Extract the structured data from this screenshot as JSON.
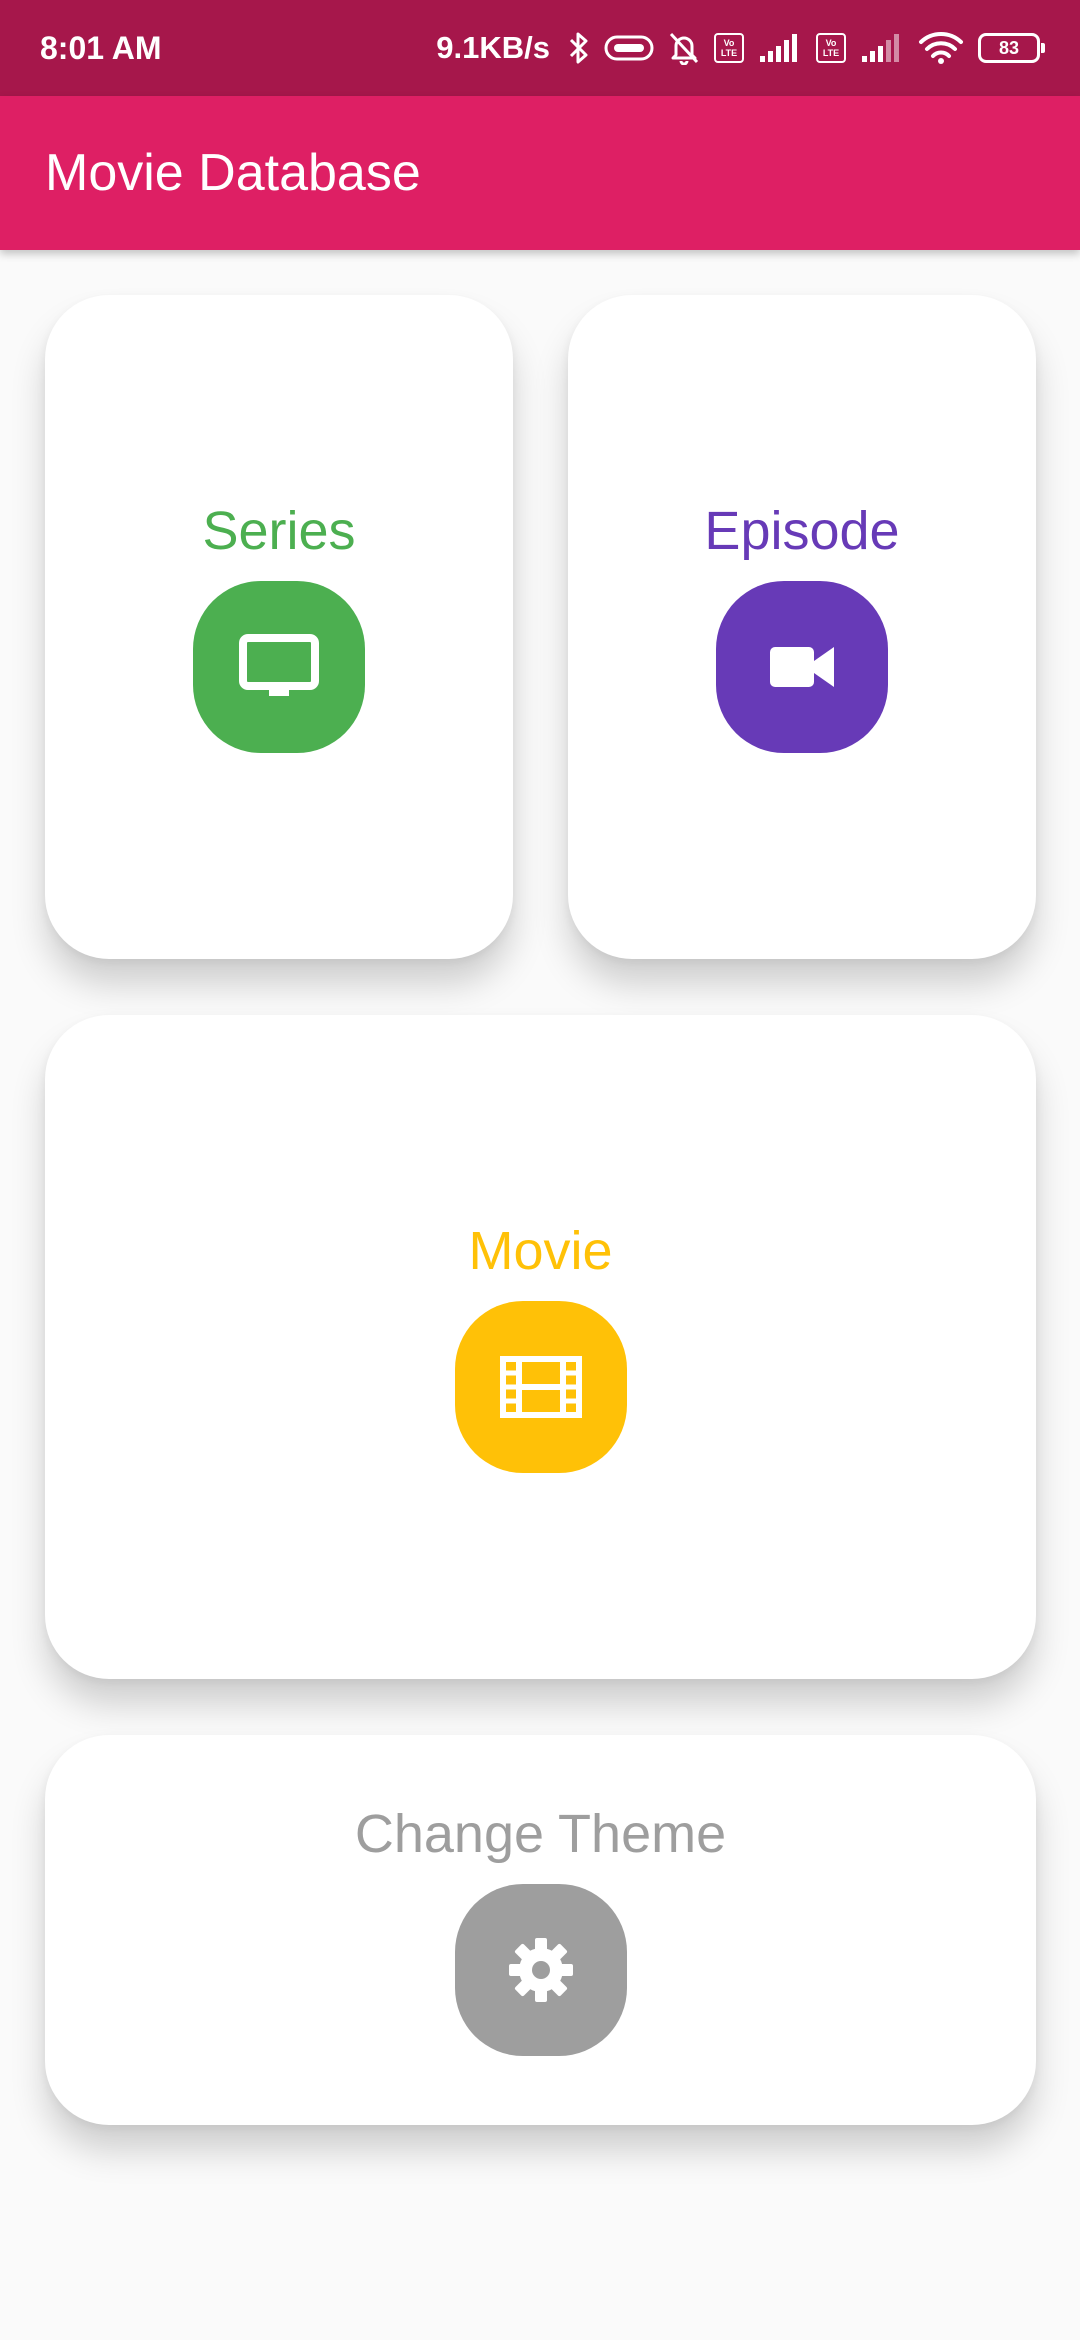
{
  "status_bar": {
    "time": "8:01 AM",
    "network_speed": "9.1KB/s",
    "volte_label_top": "Vo",
    "volte_label_bottom": "LTE",
    "battery_level": "83",
    "icons": [
      "bluetooth-icon",
      "link-icon",
      "bell-off-icon",
      "volte-icon",
      "signal-icon",
      "volte-icon",
      "signal-icon",
      "wifi-icon",
      "battery-icon"
    ]
  },
  "app_bar": {
    "title": "Movie Database",
    "color": "#de1f64"
  },
  "cards": {
    "series": {
      "label": "Series",
      "icon": "tv-icon",
      "color": "#4caf50"
    },
    "episode": {
      "label": "Episode",
      "icon": "video-camera-icon",
      "color": "#673ab7"
    },
    "movie": {
      "label": "Movie",
      "icon": "film-icon",
      "color": "#ffc107"
    },
    "theme": {
      "label": "Change Theme",
      "icon": "gear-icon",
      "color": "#9e9e9e"
    }
  }
}
